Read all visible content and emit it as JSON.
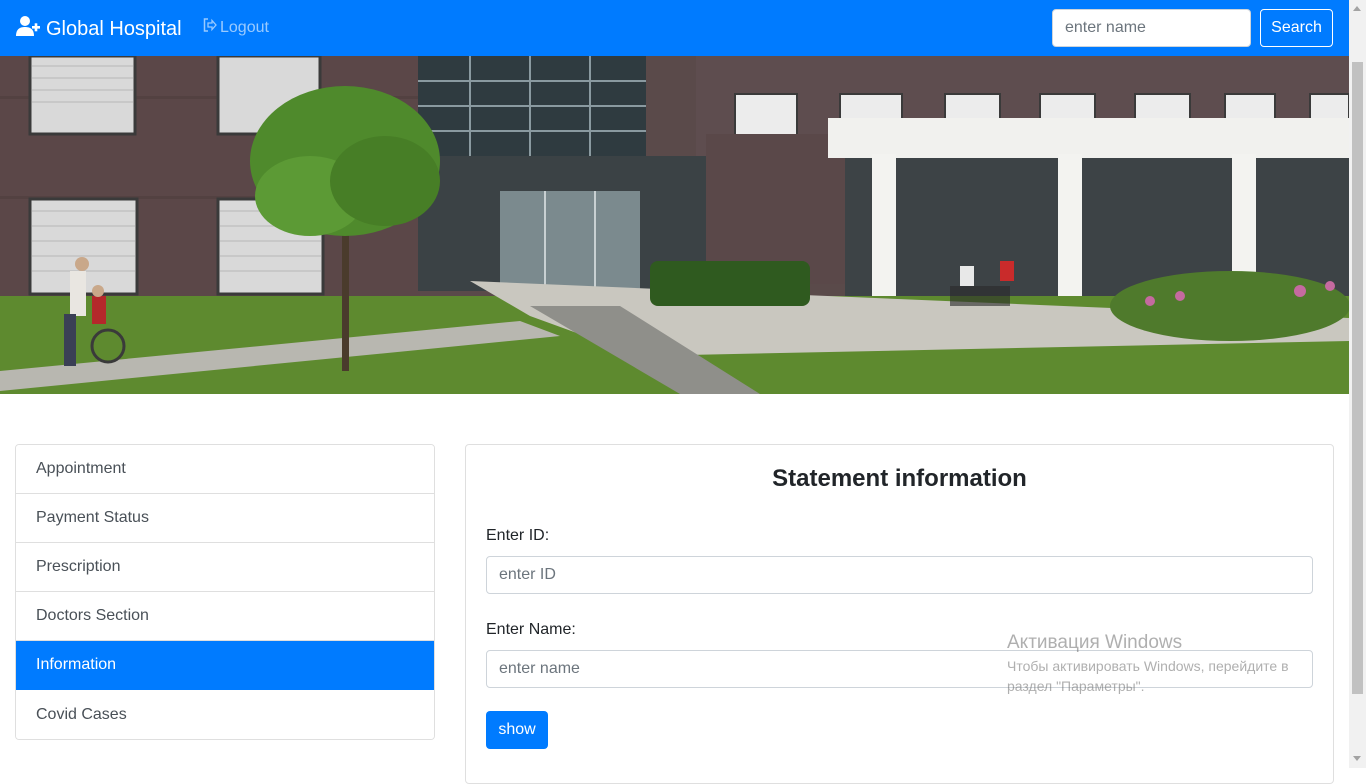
{
  "navbar": {
    "brand": "Global Hospital",
    "brand_icon": "user-plus-icon",
    "logout_label": "Logout",
    "logout_icon": "sign-out-icon",
    "search_placeholder": "enter name",
    "search_label": "Search",
    "bg_color": "#007bff"
  },
  "hero": {
    "image_description_icon": "hospital-building-photo"
  },
  "sidebar": {
    "items": [
      {
        "label": "Appointment",
        "active": false
      },
      {
        "label": "Payment Status",
        "active": false
      },
      {
        "label": "Prescription",
        "active": false
      },
      {
        "label": "Doctors Section",
        "active": false
      },
      {
        "label": "Information",
        "active": true
      },
      {
        "label": "Covid Cases",
        "active": false
      }
    ],
    "active_color": "#007bff"
  },
  "form": {
    "title": "Statement information",
    "id_label": "Enter ID:",
    "id_placeholder": "enter ID",
    "name_label": "Enter Name:",
    "name_placeholder": "enter name",
    "submit_label": "show"
  },
  "watermark": {
    "title": "Активация Windows",
    "text": "Чтобы активировать Windows, перейдите в раздел \"Параметры\"."
  }
}
